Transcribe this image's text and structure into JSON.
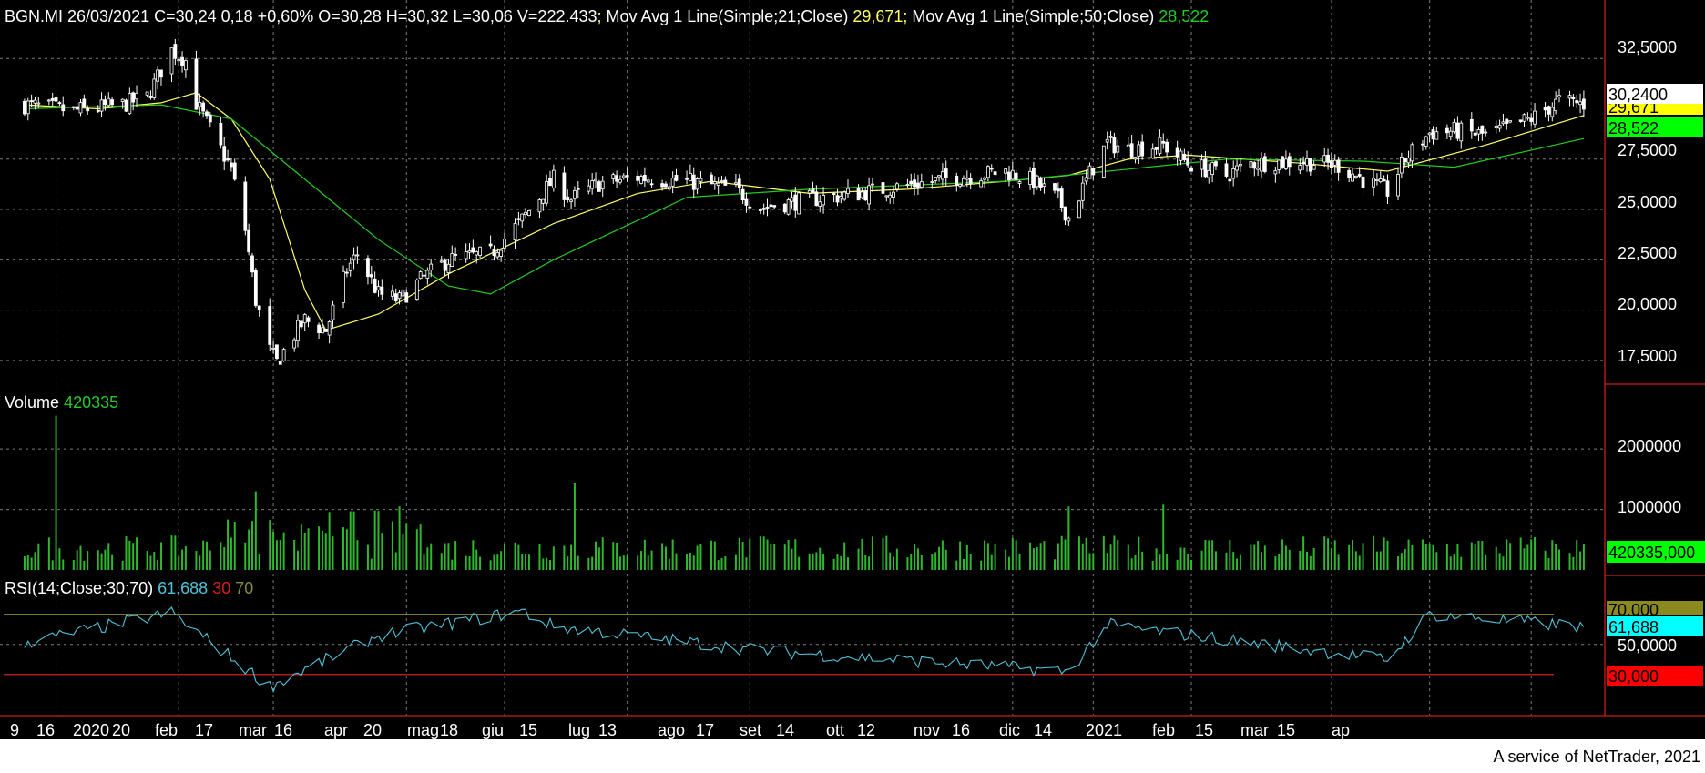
{
  "header": {
    "symbol_line": "BGN.MI 26/03/2021 C=30,24 0,18 +0,60% O=30,28 H=30,32 L=30,06 V=222.433",
    "sep1": ";",
    "ma21_label": " Mov Avg 1 Line(Simple;21;Close) ",
    "ma21_value": "29,671",
    "sep2": ";",
    "ma50_label": " Mov Avg 1 Line(Simple;50;Close) ",
    "ma50_value": "28,522"
  },
  "volume_header": {
    "label": "Volume",
    "value": "420335"
  },
  "rsi_header": {
    "label": "RSI(14;Close;30;70)",
    "value": "61,688",
    "low": "30",
    "high": "70"
  },
  "price_axis": {
    "ticks": [
      "32,5000",
      "27,5000",
      "25,0000",
      "22,5000",
      "20,0000",
      "17,5000"
    ],
    "last_close": "30,2400",
    "ma21_tag": "29,671",
    "ma50_tag": "28,522"
  },
  "volume_axis": {
    "ticks": [
      "2000000",
      "1000000"
    ],
    "last_tag": "420335,000"
  },
  "rsi_axis": {
    "ticks": [
      "50,0000"
    ],
    "high_tag": "70,000",
    "value_tag": "61,688",
    "low_tag": "30,000"
  },
  "x_axis": {
    "labels": [
      "9",
      "16",
      "2020",
      "20",
      "feb",
      "17",
      "mar",
      "16",
      "apr",
      "20",
      "mag",
      "18",
      "giu",
      "15",
      "lug",
      "13",
      "ago",
      "17",
      "set",
      "14",
      "ott",
      "12",
      "nov",
      "16",
      "dic",
      "14",
      "2021",
      "feb",
      "15",
      "mar",
      "15",
      "ap"
    ]
  },
  "footer": {
    "credit": "A service of NetTrader, 2021"
  },
  "colors": {
    "background": "#000000",
    "grid": "#7a7a7a",
    "text": "#ffffff",
    "ma21": "#ffff66",
    "ma50": "#22cc22",
    "volume": "#2db82d",
    "rsi": "#4fc3d9",
    "rsi_high": "#8a8a3a",
    "rsi_low": "#d42020",
    "axis_line": "#b01818"
  },
  "chart_data": {
    "type": "candlestick",
    "symbol": "BGN.MI",
    "last": {
      "date": "26/03/2021",
      "close": 30.24,
      "change": 0.18,
      "change_pct": 0.6,
      "open": 30.28,
      "high": 30.32,
      "low": 30.06,
      "volume": 222433
    },
    "x_range": [
      "2020-01-06",
      "2021-03-26"
    ],
    "y_range": [
      16.5,
      34.5
    ],
    "grid": true,
    "close_path": [
      [
        "2020-01-06",
        30.2
      ],
      [
        "2020-01-20",
        29.9
      ],
      [
        "2020-02-03",
        30.2
      ],
      [
        "2020-02-10",
        30.6
      ],
      [
        "2020-02-17",
        32.9
      ],
      [
        "2020-02-21",
        32.4
      ],
      [
        "2020-02-24",
        30.3
      ],
      [
        "2020-02-28",
        29.0
      ],
      [
        "2020-03-05",
        27.0
      ],
      [
        "2020-03-09",
        24.0
      ],
      [
        "2020-03-12",
        20.5
      ],
      [
        "2020-03-16",
        18.0
      ],
      [
        "2020-03-18",
        17.4
      ],
      [
        "2020-03-23",
        18.8
      ],
      [
        "2020-03-26",
        19.5
      ],
      [
        "2020-04-01",
        19.0
      ],
      [
        "2020-04-07",
        22.0
      ],
      [
        "2020-04-10",
        22.8
      ],
      [
        "2020-04-16",
        20.8
      ],
      [
        "2020-04-22",
        20.5
      ],
      [
        "2020-04-28",
        21.5
      ],
      [
        "2020-05-06",
        22.5
      ],
      [
        "2020-05-18",
        22.8
      ],
      [
        "2020-05-27",
        24.5
      ],
      [
        "2020-06-05",
        26.5
      ],
      [
        "2020-06-10",
        25.5
      ],
      [
        "2020-06-18",
        26.3
      ],
      [
        "2020-06-29",
        26.6
      ],
      [
        "2020-07-13",
        26.4
      ],
      [
        "2020-07-27",
        26.0
      ],
      [
        "2020-08-03",
        25.1
      ],
      [
        "2020-08-17",
        25.5
      ],
      [
        "2020-08-31",
        25.8
      ],
      [
        "2020-09-14",
        26.2
      ],
      [
        "2020-09-28",
        26.6
      ],
      [
        "2020-10-12",
        26.9
      ],
      [
        "2020-10-20",
        26.4
      ],
      [
        "2020-10-27",
        25.5
      ],
      [
        "2020-10-30",
        24.6
      ],
      [
        "2020-11-05",
        26.8
      ],
      [
        "2020-11-10",
        28.3
      ],
      [
        "2020-11-16",
        28.0
      ],
      [
        "2020-11-26",
        28.2
      ],
      [
        "2020-12-03",
        27.3
      ],
      [
        "2020-12-14",
        26.7
      ],
      [
        "2020-12-21",
        27.3
      ],
      [
        "2021-01-04",
        27.4
      ],
      [
        "2021-01-15",
        27.2
      ],
      [
        "2021-01-22",
        26.5
      ],
      [
        "2021-01-29",
        25.9
      ],
      [
        "2021-02-03",
        27.5
      ],
      [
        "2021-02-10",
        28.8
      ],
      [
        "2021-02-17",
        28.9
      ],
      [
        "2021-02-26",
        28.7
      ],
      [
        "2021-03-05",
        29.1
      ],
      [
        "2021-03-12",
        29.6
      ],
      [
        "2021-03-19",
        30.4
      ],
      [
        "2021-03-26",
        30.24
      ]
    ],
    "series": [
      {
        "name": "Mov Avg 1 Line(Simple;21;Close)",
        "x": [
          "2020-01-06",
          "2020-01-27",
          "2020-02-14",
          "2020-02-24",
          "2020-03-05",
          "2020-03-16",
          "2020-03-26",
          "2020-04-01",
          "2020-04-16",
          "2020-05-06",
          "2020-06-05",
          "2020-06-29",
          "2020-07-20",
          "2020-08-17",
          "2020-09-14",
          "2020-10-12",
          "2020-10-30",
          "2020-11-16",
          "2020-12-03",
          "2021-01-04",
          "2021-01-29",
          "2021-02-26",
          "2021-03-26"
        ],
        "y": [
          30.2,
          30.0,
          30.3,
          30.8,
          29.5,
          26.5,
          21.0,
          19.0,
          19.8,
          21.8,
          24.3,
          25.8,
          26.4,
          25.8,
          26.0,
          26.4,
          26.7,
          27.5,
          27.7,
          27.3,
          26.9,
          28.2,
          29.671
        ]
      },
      {
        "name": "Mov Avg 1 Line(Simple;50;Close)",
        "x": [
          "2020-01-06",
          "2020-02-14",
          "2020-03-05",
          "2020-03-26",
          "2020-04-16",
          "2020-05-06",
          "2020-05-18",
          "2020-06-05",
          "2020-07-13",
          "2020-08-17",
          "2020-10-12",
          "2020-11-16",
          "2020-12-14",
          "2021-01-22",
          "2021-02-17",
          "2021-03-26"
        ],
        "y": [
          30.0,
          30.2,
          29.5,
          26.5,
          23.5,
          21.2,
          20.8,
          22.5,
          25.6,
          26.0,
          26.4,
          27.0,
          27.5,
          27.4,
          27.1,
          28.522
        ]
      }
    ],
    "volume": {
      "last": 420335,
      "peaks": [
        [
          "2020-01-15",
          2550000
        ],
        [
          "2020-03-12",
          1300000
        ],
        [
          "2020-06-11",
          1440000
        ],
        [
          "2020-10-30",
          1050000
        ],
        [
          "2020-11-26",
          1080000
        ]
      ],
      "y_range": [
        0,
        2800000
      ]
    },
    "rsi": {
      "period": 14,
      "levels": [
        30,
        70
      ],
      "last": 61.688,
      "points": [
        [
          "2020-01-06",
          51
        ],
        [
          "2020-02-17",
          71
        ],
        [
          "2020-03-16",
          22
        ],
        [
          "2020-04-16",
          56
        ],
        [
          "2020-05-27",
          72
        ],
        [
          "2020-06-05",
          62
        ],
        [
          "2020-08-03",
          46
        ],
        [
          "2020-10-30",
          32
        ],
        [
          "2020-11-10",
          63
        ],
        [
          "2021-01-29",
          40
        ],
        [
          "2021-02-10",
          70
        ],
        [
          "2021-03-26",
          61.688
        ]
      ],
      "y_range": [
        5,
        85
      ]
    }
  }
}
